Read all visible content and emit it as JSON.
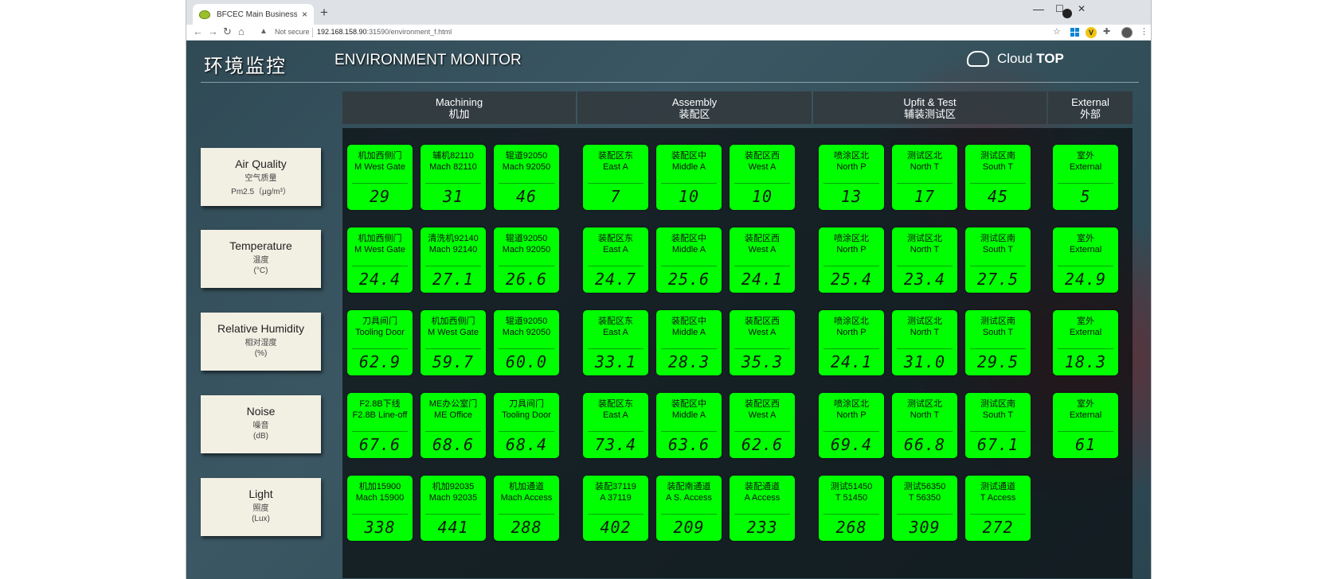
{
  "browser": {
    "tab_title": "BFCEC Main Business Process",
    "tab_close": "×",
    "new_tab": "+",
    "not_secure": "Not secure",
    "url_host": "192.168.158.90",
    "url_path": ":31590/environment_f.html",
    "min_glyph": "—",
    "max_glyph": "☐",
    "close_glyph": "✕"
  },
  "header": {
    "title_cn": "环境监控",
    "title_en": "ENVIRONMENT MONITOR",
    "brand_left": "Cloud",
    "brand_right": "TOP"
  },
  "groups": [
    {
      "en": "Machining",
      "cn": "机加"
    },
    {
      "en": "Assembly",
      "cn": "装配区"
    },
    {
      "en": "Upfit & Test",
      "cn": "辅装测试区"
    },
    {
      "en": "External",
      "cn": "外部"
    }
  ],
  "rows": [
    {
      "label_en": "Air Quality",
      "label_cn": "空气质量",
      "unit": "Pm2.5（μg/m³）",
      "tiles": [
        {
          "cn": "机加西侧门",
          "en": "M West Gate",
          "value": "29"
        },
        {
          "cn": "辅机82110",
          "en": "Mach 82110",
          "value": "31"
        },
        {
          "cn": "辊道92050",
          "en": "Mach 92050",
          "value": "46"
        },
        {
          "cn": "装配区东",
          "en": "East A",
          "value": "7"
        },
        {
          "cn": "装配区中",
          "en": "Middle A",
          "value": "10"
        },
        {
          "cn": "装配区西",
          "en": "West A",
          "value": "10"
        },
        {
          "cn": "喷涂区北",
          "en": "North P",
          "value": "13"
        },
        {
          "cn": "测试区北",
          "en": "North T",
          "value": "17"
        },
        {
          "cn": "测试区南",
          "en": "South T",
          "value": "45"
        },
        {
          "cn": "室外",
          "en": "External",
          "value": "5"
        }
      ]
    },
    {
      "label_en": "Temperature",
      "label_cn": "温度",
      "unit": "(°C)",
      "tiles": [
        {
          "cn": "机加西侧门",
          "en": "M West Gate",
          "value": "24.4"
        },
        {
          "cn": "清洗机92140",
          "en": "Mach 92140",
          "value": "27.1"
        },
        {
          "cn": "辊道92050",
          "en": "Mach 92050",
          "value": "26.6"
        },
        {
          "cn": "装配区东",
          "en": "East A",
          "value": "24.7"
        },
        {
          "cn": "装配区中",
          "en": "Middle A",
          "value": "25.6"
        },
        {
          "cn": "装配区西",
          "en": "West A",
          "value": "24.1"
        },
        {
          "cn": "喷涂区北",
          "en": "North P",
          "value": "25.4"
        },
        {
          "cn": "测试区北",
          "en": "North T",
          "value": "23.4"
        },
        {
          "cn": "测试区南",
          "en": "South T",
          "value": "27.5"
        },
        {
          "cn": "室外",
          "en": "External",
          "value": "24.9"
        }
      ]
    },
    {
      "label_en": "Relative Humidity",
      "label_cn": "相对湿度",
      "unit": "(%)",
      "tiles": [
        {
          "cn": "刀具间门",
          "en": "Tooling Door",
          "value": "62.9"
        },
        {
          "cn": "机加西侧门",
          "en": "M West Gate",
          "value": "59.7"
        },
        {
          "cn": "辊道92050",
          "en": "Mach 92050",
          "value": "60.0"
        },
        {
          "cn": "装配区东",
          "en": "East A",
          "value": "33.1"
        },
        {
          "cn": "装配区中",
          "en": "Middle A",
          "value": "28.3"
        },
        {
          "cn": "装配区西",
          "en": "West A",
          "value": "35.3"
        },
        {
          "cn": "喷涂区北",
          "en": "North P",
          "value": "24.1"
        },
        {
          "cn": "测试区北",
          "en": "North T",
          "value": "31.0"
        },
        {
          "cn": "测试区南",
          "en": "South T",
          "value": "29.5"
        },
        {
          "cn": "室外",
          "en": "External",
          "value": "18.3"
        }
      ]
    },
    {
      "label_en": "Noise",
      "label_cn": "噪音",
      "unit": "(dB)",
      "tiles": [
        {
          "cn": "F2.8B下线",
          "en": "F2.8B Line-off",
          "value": "67.6"
        },
        {
          "cn": "ME办公室门",
          "en": "ME Office",
          "value": "68.6"
        },
        {
          "cn": "刀具间门",
          "en": "Tooling Door",
          "value": "68.4"
        },
        {
          "cn": "装配区东",
          "en": "East A",
          "value": "73.4"
        },
        {
          "cn": "装配区中",
          "en": "Middle A",
          "value": "63.6"
        },
        {
          "cn": "装配区西",
          "en": "West A",
          "value": "62.6"
        },
        {
          "cn": "喷涂区北",
          "en": "North P",
          "value": "69.4"
        },
        {
          "cn": "测试区北",
          "en": "North T",
          "value": "66.8"
        },
        {
          "cn": "测试区南",
          "en": "South T",
          "value": "67.1"
        },
        {
          "cn": "室外",
          "en": "External",
          "value": "61"
        }
      ]
    },
    {
      "label_en": "Light",
      "label_cn": "照度",
      "unit": "(Lux)",
      "tiles": [
        {
          "cn": "机加15900",
          "en": "Mach 15900",
          "value": "338"
        },
        {
          "cn": "机加92035",
          "en": "Mach 92035",
          "value": "441"
        },
        {
          "cn": "机加通道",
          "en": "Mach Access",
          "value": "288"
        },
        {
          "cn": "装配37119",
          "en": "A 37119",
          "value": "402"
        },
        {
          "cn": "装配南通道",
          "en": "A S. Access",
          "value": "209"
        },
        {
          "cn": "装配通道",
          "en": "A Access",
          "value": "233"
        },
        {
          "cn": "测试51450",
          "en": "T 51450",
          "value": "268"
        },
        {
          "cn": "测试56350",
          "en": "T 56350",
          "value": "309"
        },
        {
          "cn": "测试通道",
          "en": "T Access",
          "value": "272"
        }
      ]
    }
  ]
}
